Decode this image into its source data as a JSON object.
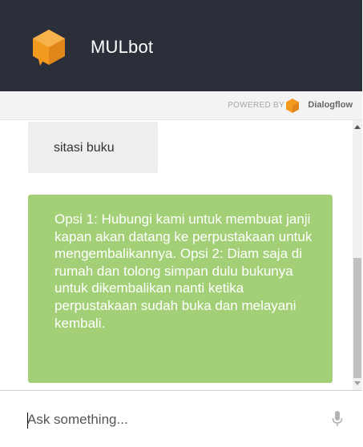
{
  "header": {
    "title": "MULbot"
  },
  "powered_bar": {
    "powered_by": "POWERED BY",
    "brand": "Dialogflow"
  },
  "messages": [
    {
      "from": "user",
      "text": "sitasi buku"
    },
    {
      "from": "bot",
      "text": "Opsi 1: Hubungi kami untuk membuat janji kapan akan datang ke perpustakaan untuk mengembalikannya. Opsi 2: Diam saja di rumah dan tolong simpan dulu bukunya untuk dikembalikan nanti ketika perpustakaan sudah buka dan melayani kembali."
    }
  ],
  "input": {
    "placeholder": "Ask something...",
    "value": ""
  },
  "colors": {
    "header_bg": "#2b2f3a",
    "logo_orange": "#f39a1f",
    "user_bubble": "#eeeeee",
    "bot_bubble": "#a3d077"
  },
  "icons": {
    "logo": "chat-bubble-logo-icon",
    "brand": "dialogflow-icon",
    "mic": "microphone-icon"
  }
}
